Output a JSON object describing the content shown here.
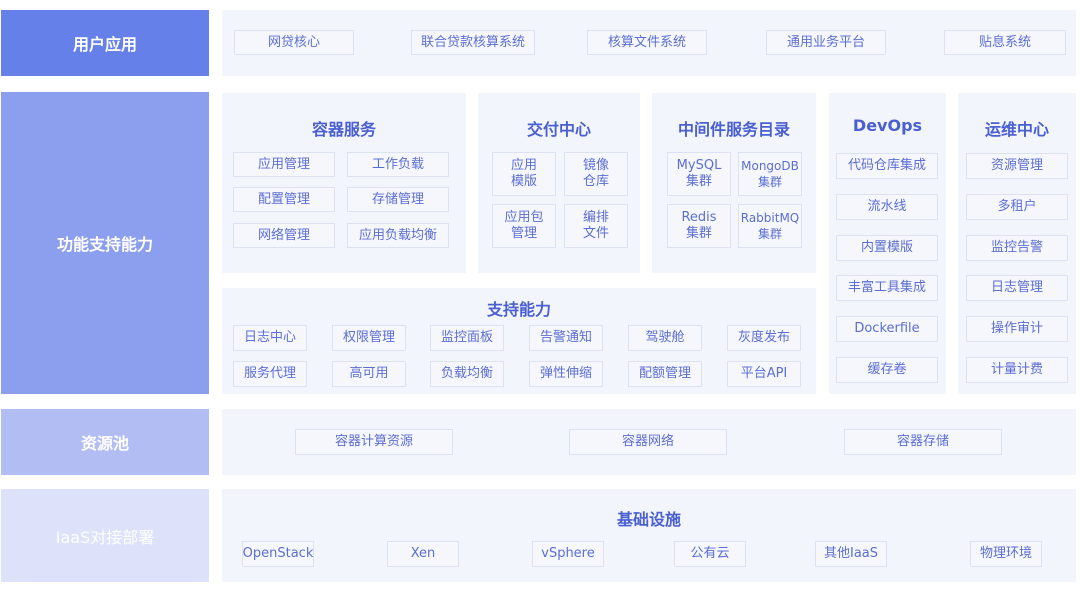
{
  "layers": {
    "user_app": {
      "label": "用户应用",
      "items": [
        "网贷核心",
        "联合贷款核算系统",
        "核算文件系统",
        "通用业务平台",
        "贴息系统"
      ]
    },
    "function_support": {
      "label": "功能支持能力",
      "container_service": {
        "title": "容器服务",
        "items": [
          "应用管理",
          "工作负载",
          "配置管理",
          "存储管理",
          "网络管理",
          "应用负载均衡"
        ]
      },
      "delivery_center": {
        "title": "交付中心",
        "items": [
          "应用\n模版",
          "镜像\n仓库",
          "应用包\n管理",
          "编排\n文件"
        ]
      },
      "middleware_catalog": {
        "title": "中间件服务目录",
        "items": [
          "MySQL\n集群",
          "MongoDB\n集群",
          "Redis\n集群",
          "RabbitMQ\n集群"
        ]
      },
      "devops": {
        "title": "DevOps",
        "items": [
          "代码仓库集成",
          "流水线",
          "内置模版",
          "丰富工具集成",
          "Dockerfile",
          "缓存卷"
        ]
      },
      "ops_center": {
        "title": "运维中心",
        "items": [
          "资源管理",
          "多租户",
          "监控告警",
          "日志管理",
          "操作审计",
          "计量计费"
        ]
      },
      "support_capability": {
        "title": "支持能力",
        "items": [
          "日志中心",
          "权限管理",
          "监控面板",
          "告警通知",
          "驾驶舱",
          "灰度发布",
          "服务代理",
          "高可用",
          "负载均衡",
          "弹性伸缩",
          "配额管理",
          "平台API"
        ]
      }
    },
    "resource_pool": {
      "label": "资源池",
      "items": [
        "容器计算资源",
        "容器网络",
        "容器存储"
      ]
    },
    "iaas": {
      "label": "IaaS对接部署",
      "title": "基础设施",
      "items": [
        "OpenStack",
        "Xen",
        "vSphere",
        "公有云",
        "其他IaaS",
        "物理环境"
      ]
    }
  },
  "colors": {
    "layer1": "#6680ea",
    "layer2": "#8c9eee",
    "layer3": "#b2bdf4",
    "layer4": "#dde2fa",
    "panel": "#f3f5fd",
    "text": "#5b6ed3"
  }
}
